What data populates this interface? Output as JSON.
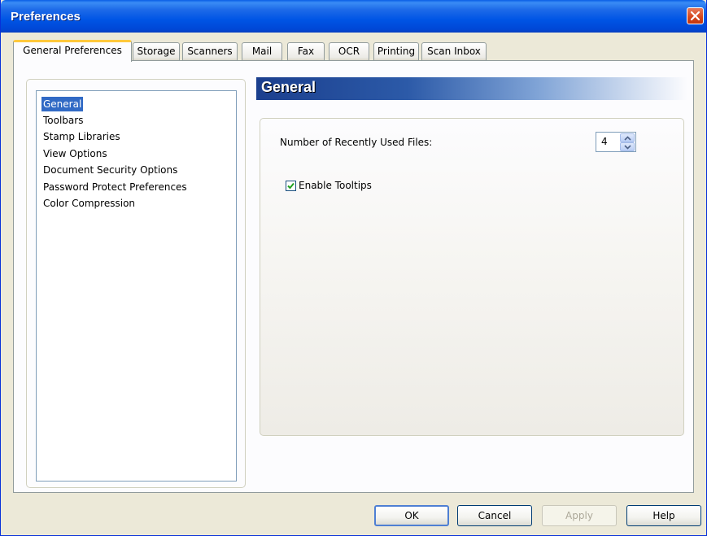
{
  "window": {
    "title": "Preferences"
  },
  "tabs": [
    {
      "label": "General Preferences",
      "active": true
    },
    {
      "label": "Storage"
    },
    {
      "label": "Scanners"
    },
    {
      "label": "Mail"
    },
    {
      "label": "Fax"
    },
    {
      "label": "OCR"
    },
    {
      "label": "Printing"
    },
    {
      "label": "Scan Inbox"
    }
  ],
  "sidebar": {
    "items": [
      {
        "label": "General",
        "selected": true
      },
      {
        "label": "Toolbars"
      },
      {
        "label": "Stamp Libraries"
      },
      {
        "label": "View Options"
      },
      {
        "label": "Document Security Options"
      },
      {
        "label": "Password Protect Preferences"
      },
      {
        "label": "Color Compression"
      }
    ]
  },
  "section": {
    "title": "General",
    "recent_files_label": "Number of Recently Used Files:",
    "recent_files_value": "4",
    "tooltips_label": "Enable Tooltips",
    "tooltips_checked": true
  },
  "buttons": {
    "ok": "OK",
    "cancel": "Cancel",
    "apply": "Apply",
    "help": "Help"
  },
  "colors": {
    "titlebar": "#0055e5",
    "selection": "#316ac5",
    "tab_highlight": "#ffc83c",
    "close": "#d5461c"
  }
}
